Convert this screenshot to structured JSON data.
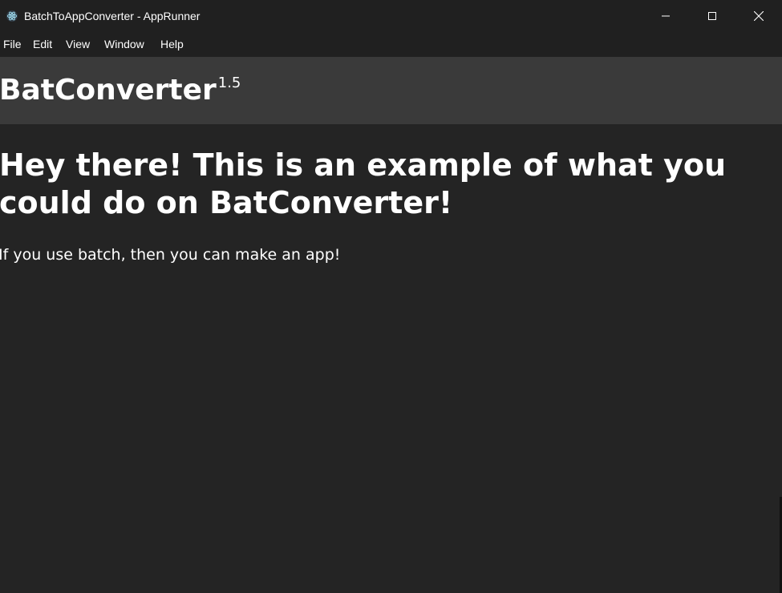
{
  "window": {
    "title": "BatchToAppConverter - AppRunner",
    "app_icon": "electron-atom-icon",
    "controls": {
      "minimize_icon": "minimize-icon",
      "maximize_icon": "maximize-icon",
      "close_icon": "close-icon"
    }
  },
  "menu": {
    "items": [
      {
        "label": "File"
      },
      {
        "label": "Edit"
      },
      {
        "label": "View"
      },
      {
        "label": "Window"
      },
      {
        "label": "Help"
      }
    ]
  },
  "header": {
    "brand": "BatConverter",
    "version": "1.5"
  },
  "content": {
    "heading": "Hey there! This is an example of what you could do on BatConverter!",
    "text": "If you use batch, then you can make an app!"
  },
  "colors": {
    "titlebar": "#202020",
    "header_bg": "#3a3a3a",
    "content_bg": "#242424",
    "text": "#ffffff"
  }
}
